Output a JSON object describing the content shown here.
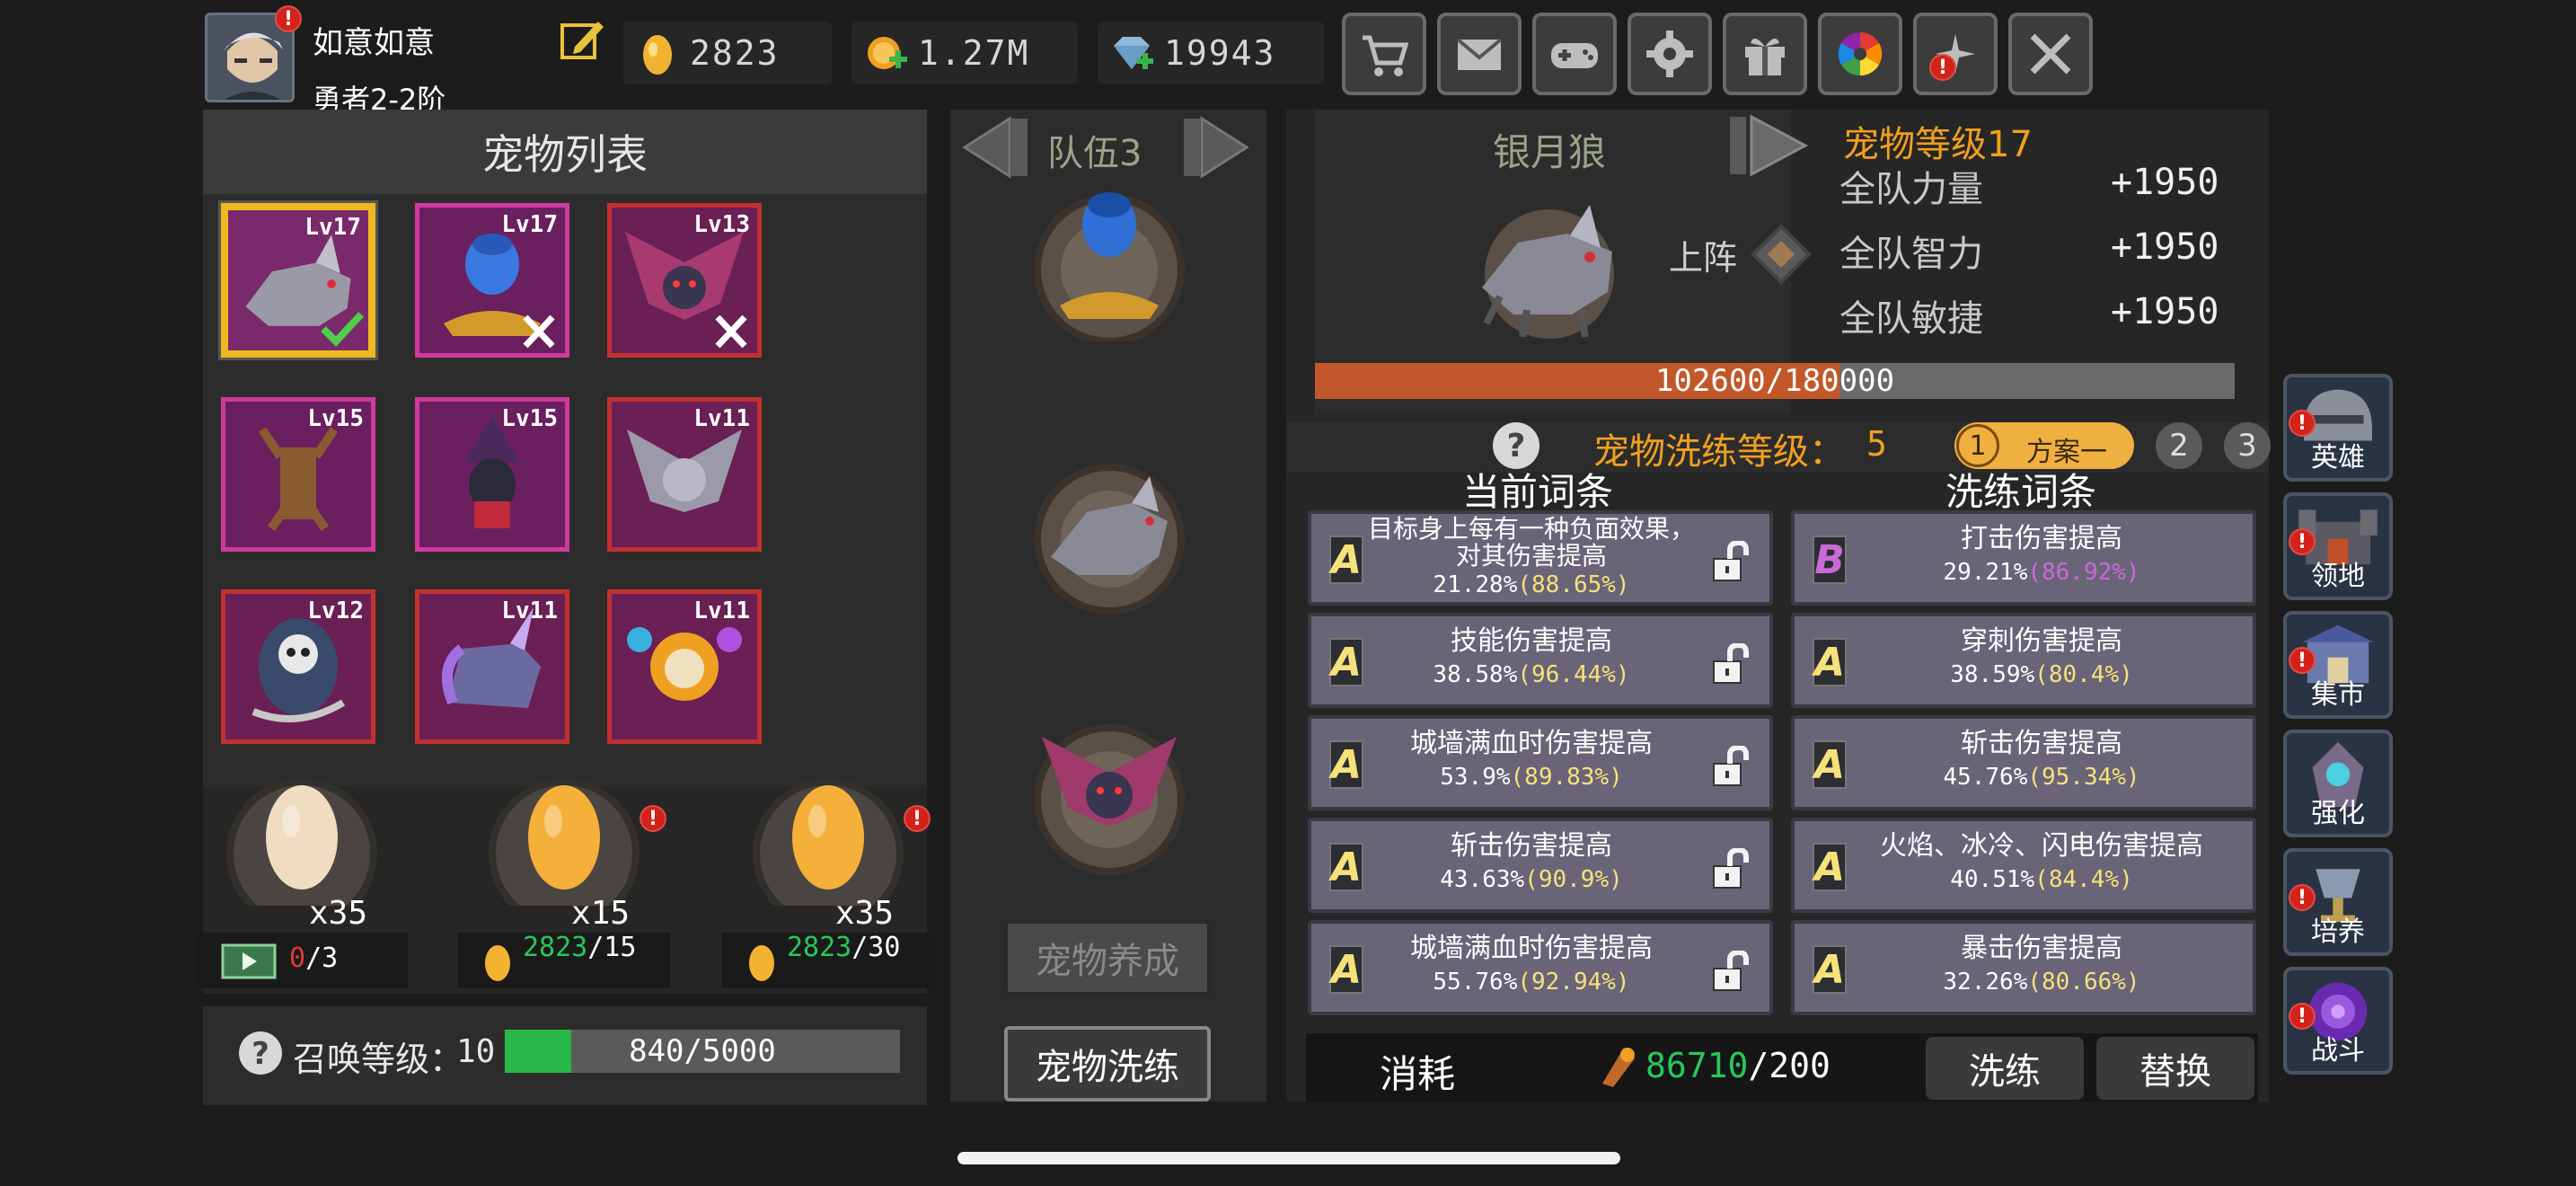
{
  "player": {
    "name": "如意如意",
    "rank": "勇者2-2阶"
  },
  "resources": {
    "eggs": "2823",
    "gold": "1.27M",
    "gems": "19943"
  },
  "top_icons": [
    "cart-icon",
    "mail-icon",
    "gamepad-icon",
    "settings-icon",
    "gift-icon",
    "color-wheel-icon",
    "sparkle-icon",
    "crossed-swords-icon"
  ],
  "pet_list": {
    "title": "宠物列表",
    "pets": [
      {
        "level": "Lv17",
        "name": "silver-wolf",
        "frame": "gold",
        "status": "check"
      },
      {
        "level": "Lv17",
        "name": "genie",
        "frame": "purple",
        "status": "x"
      },
      {
        "level": "Lv13",
        "name": "bat",
        "frame": "red",
        "status": "x"
      },
      {
        "level": "Lv15",
        "name": "treant",
        "frame": "purple",
        "status": ""
      },
      {
        "level": "Lv15",
        "name": "witch",
        "frame": "purple",
        "status": ""
      },
      {
        "level": "Lv11",
        "name": "gray-bat",
        "frame": "red",
        "status": ""
      },
      {
        "level": "Lv12",
        "name": "reaper",
        "frame": "red",
        "status": ""
      },
      {
        "level": "Lv11",
        "name": "unicorn",
        "frame": "red",
        "status": ""
      },
      {
        "level": "Lv11",
        "name": "fire-skull",
        "frame": "red",
        "status": ""
      }
    ]
  },
  "eggs": [
    {
      "count": "x35",
      "cost_current": "0",
      "cost_total": "/3",
      "kind": "video"
    },
    {
      "count": "x15",
      "cost_current": "2823",
      "cost_total": "/15",
      "kind": "egg"
    },
    {
      "count": "x35",
      "cost_current": "2823",
      "cost_total": "/30",
      "kind": "egg"
    }
  ],
  "summon": {
    "label": "召唤等级：",
    "level": "10",
    "progress_text": "840/5000",
    "progress": 0.168
  },
  "team": {
    "label": "队伍3",
    "buttons": {
      "raise": "宠物养成",
      "refine": "宠物洗练"
    }
  },
  "detail": {
    "pet_name": "银月狼",
    "pet_level_label": "宠物等级17",
    "deploy_label": "上阵",
    "attributes": [
      {
        "label": "全队力量",
        "value": "+1950"
      },
      {
        "label": "全队智力",
        "value": "+1950"
      },
      {
        "label": "全队敏捷",
        "value": "+1950"
      }
    ],
    "exp_text": "102600/180000",
    "exp_progress": 0.57,
    "refine_level_label": "宠物洗练等级：",
    "refine_level": "5",
    "plans": [
      "1",
      "方案一",
      "2",
      "3"
    ],
    "current_header": "当前词条",
    "refine_header": "洗练词条",
    "current": [
      {
        "grade": "A",
        "title": "目标身上每有一种负面效果，对其伤害提高",
        "pct": "21.28%",
        "max": "(88.65%)"
      },
      {
        "grade": "A",
        "title": "技能伤害提高",
        "pct": "38.58%",
        "max": "(96.44%)"
      },
      {
        "grade": "A",
        "title": "城墙满血时伤害提高",
        "pct": "53.9%",
        "max": "(89.83%)"
      },
      {
        "grade": "A",
        "title": "斩击伤害提高",
        "pct": "43.63%",
        "max": "(90.9%)"
      },
      {
        "grade": "A",
        "title": "城墙满血时伤害提高",
        "pct": "55.76%",
        "max": "(92.94%)"
      }
    ],
    "refine": [
      {
        "grade": "B",
        "title": "打击伤害提高",
        "pct": "29.21%",
        "max": "(86.92%)"
      },
      {
        "grade": "A",
        "title": "穿刺伤害提高",
        "pct": "38.59%",
        "max": "(80.4%)"
      },
      {
        "grade": "A",
        "title": "斩击伤害提高",
        "pct": "45.76%",
        "max": "(95.34%)"
      },
      {
        "grade": "A",
        "title": "火焰、冰冷、闪电伤害提高",
        "pct": "40.51%",
        "max": "(84.4%)"
      },
      {
        "grade": "A",
        "title": "暴击伤害提高",
        "pct": "32.26%",
        "max": "(80.66%)"
      }
    ],
    "cost_label": "消耗",
    "cost_current": "86710",
    "cost_total": "/200",
    "refine_button": "洗练",
    "replace_button": "替换"
  },
  "side_menu": [
    "英雄",
    "领地",
    "集市",
    "强化",
    "培养",
    "战斗"
  ],
  "colors": {
    "accent_orange": "#f0a020",
    "green": "#28b84a",
    "purple_text": "#c86ad8",
    "yellow_text": "#f5e27a",
    "badge_red": "#d3221a"
  }
}
